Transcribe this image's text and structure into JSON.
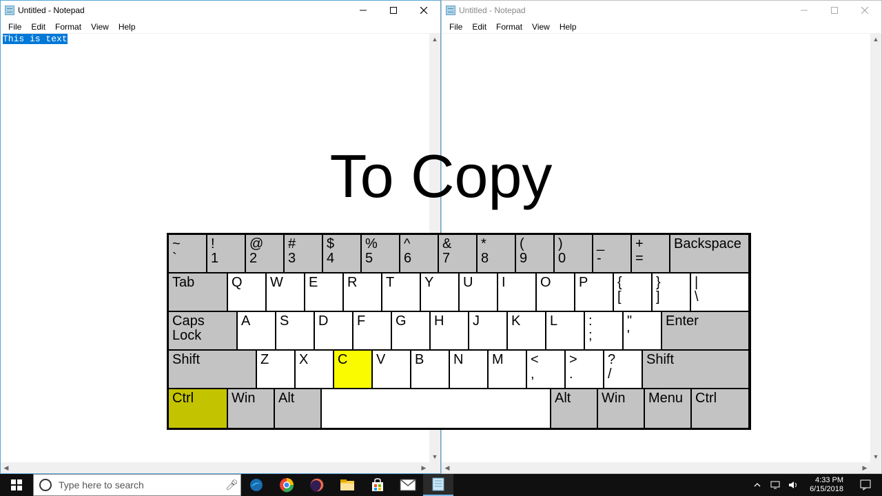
{
  "windows": {
    "left": {
      "title": "Untitled - Notepad",
      "menu": [
        "File",
        "Edit",
        "Format",
        "View",
        "Help"
      ],
      "selected_text": "This is text"
    },
    "right": {
      "title": "Untitled - Notepad",
      "menu": [
        "File",
        "Edit",
        "Format",
        "View",
        "Help"
      ]
    }
  },
  "overlay": {
    "heading": "To Copy"
  },
  "keyboard": {
    "row1": [
      {
        "u": "~",
        "l": "`"
      },
      {
        "u": "!",
        "l": "1"
      },
      {
        "u": "@",
        "l": "2"
      },
      {
        "u": "#",
        "l": "3"
      },
      {
        "u": "$",
        "l": "4"
      },
      {
        "u": "%",
        "l": "5"
      },
      {
        "u": "^",
        "l": "6"
      },
      {
        "u": "&",
        "l": "7"
      },
      {
        "u": "*",
        "l": "8"
      },
      {
        "u": "(",
        "l": "9"
      },
      {
        "u": ")",
        "l": "0"
      },
      {
        "u": "_",
        "l": "-"
      },
      {
        "u": "+",
        "l": "="
      }
    ],
    "backspace": "Backspace",
    "tab": "Tab",
    "row2": [
      "Q",
      "W",
      "E",
      "R",
      "T",
      "Y",
      "U",
      "I",
      "O",
      "P"
    ],
    "row2sym": [
      {
        "u": "{",
        "l": "["
      },
      {
        "u": "}",
        "l": "]"
      },
      {
        "u": "|",
        "l": "\\"
      }
    ],
    "caps": "Caps Lock",
    "row3": [
      "A",
      "S",
      "D",
      "F",
      "G",
      "H",
      "J",
      "K",
      "L"
    ],
    "row3sym": [
      {
        "u": ":",
        "l": ";"
      },
      {
        "u": "\"",
        "l": "'"
      }
    ],
    "enter": "Enter",
    "shift": "Shift",
    "row4": [
      "Z",
      "X",
      "C",
      "V",
      "B",
      "N",
      "M"
    ],
    "row4sym": [
      {
        "u": "<",
        "l": ","
      },
      {
        "u": ">",
        "l": "."
      },
      {
        "u": "?",
        "l": "/"
      }
    ],
    "bottom": {
      "ctrl": "Ctrl",
      "win": "Win",
      "alt": "Alt",
      "menu": "Menu"
    }
  },
  "taskbar": {
    "search_placeholder": "Type here to search",
    "time": "4:33 PM",
    "date": "6/15/2018"
  }
}
